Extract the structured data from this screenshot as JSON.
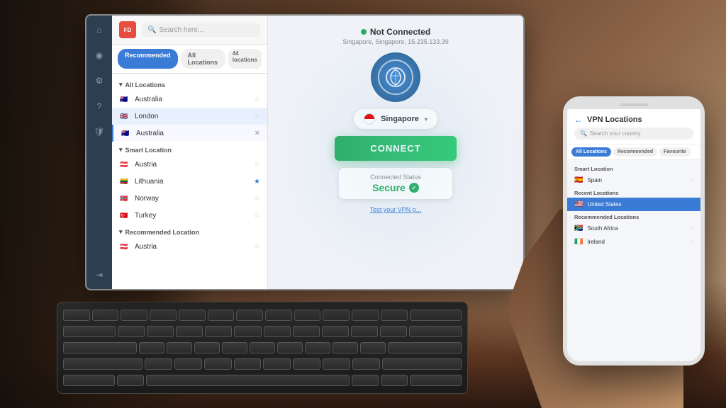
{
  "scene": {
    "bg_color": "#3d2b1f"
  },
  "laptop": {
    "vpn_app": {
      "logo": "FD",
      "search_placeholder": "Search here...",
      "tabs": [
        {
          "label": "Recommended",
          "active": true
        },
        {
          "label": "All Locations",
          "active": false
        }
      ],
      "locations_count": "44 locations",
      "sections": [
        {
          "name": "All Locations",
          "items": [
            {
              "name": "Australia",
              "flag": "🇦🇺"
            },
            {
              "name": "London",
              "flag": "🇬🇧",
              "selected": true
            },
            {
              "name": "Australia",
              "flag": "🇦🇺",
              "hasClose": true
            }
          ]
        },
        {
          "name": "Smart Location",
          "items": [
            {
              "name": "Austria",
              "flag": "🇦🇹"
            },
            {
              "name": "Lithuania",
              "flag": "🇱🇹"
            },
            {
              "name": "Norway",
              "flag": "🇳🇴",
              "hasStar": true,
              "starActive": true
            },
            {
              "name": "Turkey",
              "flag": "🇹🇷"
            }
          ]
        },
        {
          "name": "Recommended Location",
          "items": [
            {
              "name": "Austria",
              "flag": "🇦🇹"
            }
          ]
        }
      ],
      "main_panel": {
        "status": "Not Connected",
        "ip": "Singapore, Singapore, 15.235.133.39",
        "selected_location": "Singapore",
        "connect_btn": "CONNECT",
        "connected_status_label": "Connected Status",
        "secure_label": "Secure",
        "test_link": "Test your VPN p..."
      }
    }
  },
  "phone": {
    "title": "VPN Locations",
    "search_placeholder": "Search your country",
    "tabs": [
      {
        "label": "All Locations",
        "active": true
      },
      {
        "label": "Recommended",
        "active": false
      },
      {
        "label": "Favourite",
        "active": false
      }
    ],
    "sections": [
      {
        "name": "Smart Location",
        "items": [
          {
            "name": "Spain",
            "flag_color": "#e74c3c"
          }
        ]
      },
      {
        "name": "Recent Locations",
        "items": [
          {
            "name": "United States",
            "flag_color": "#3a5fa0",
            "highlighted": true
          }
        ]
      },
      {
        "name": "Recommended Locations",
        "items": [
          {
            "name": "South Africa",
            "flag_color": "#27ae60"
          },
          {
            "name": "Ireland",
            "flag_color": "#2ecc71"
          }
        ]
      }
    ]
  }
}
